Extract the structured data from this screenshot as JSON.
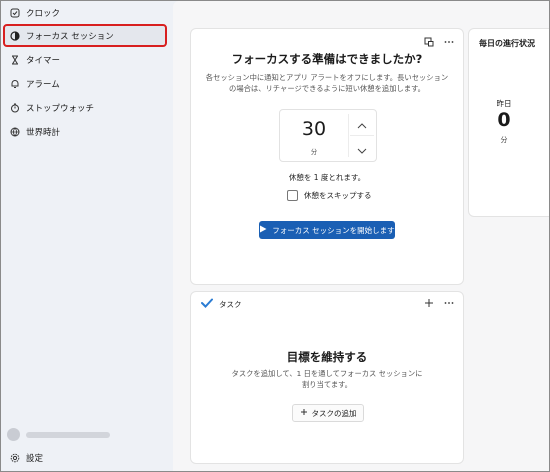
{
  "sidebar": {
    "items": [
      {
        "label": "クロック",
        "icon": "clock-icon"
      },
      {
        "label": "フォーカス セッション",
        "icon": "focus-icon",
        "active": true
      },
      {
        "label": "タイマー",
        "icon": "hourglass-icon"
      },
      {
        "label": "アラーム",
        "icon": "bell-icon"
      },
      {
        "label": "ストップウォッチ",
        "icon": "stopwatch-icon"
      },
      {
        "label": "世界時計",
        "icon": "globe-icon"
      }
    ],
    "settings_label": "設定"
  },
  "focus": {
    "title": "フォーカスする準備はできましたか?",
    "description": "各セッション中に通知とアプリ アラートをオフにします。長いセッションの場合は、リチャージできるように短い休憩を追加します。",
    "time_value": "30",
    "time_unit": "分",
    "break_text": "休憩を 1 度とれます。",
    "skip_label": "休憩をスキップする",
    "start_label": "フォーカス セッションを開始します"
  },
  "progress": {
    "title": "毎日の進行状況",
    "yesterday_label": "昨日",
    "yesterday_value": "0",
    "unit": "分"
  },
  "tasks": {
    "header": "タスク",
    "title": "目標を維持する",
    "description": "タスクを追加して、1 日を通してフォーカス セッションに割り当てます。",
    "add_label": "タスクの追加"
  },
  "colors": {
    "accent": "#1a5fb4",
    "highlight": "#d81f1f"
  }
}
